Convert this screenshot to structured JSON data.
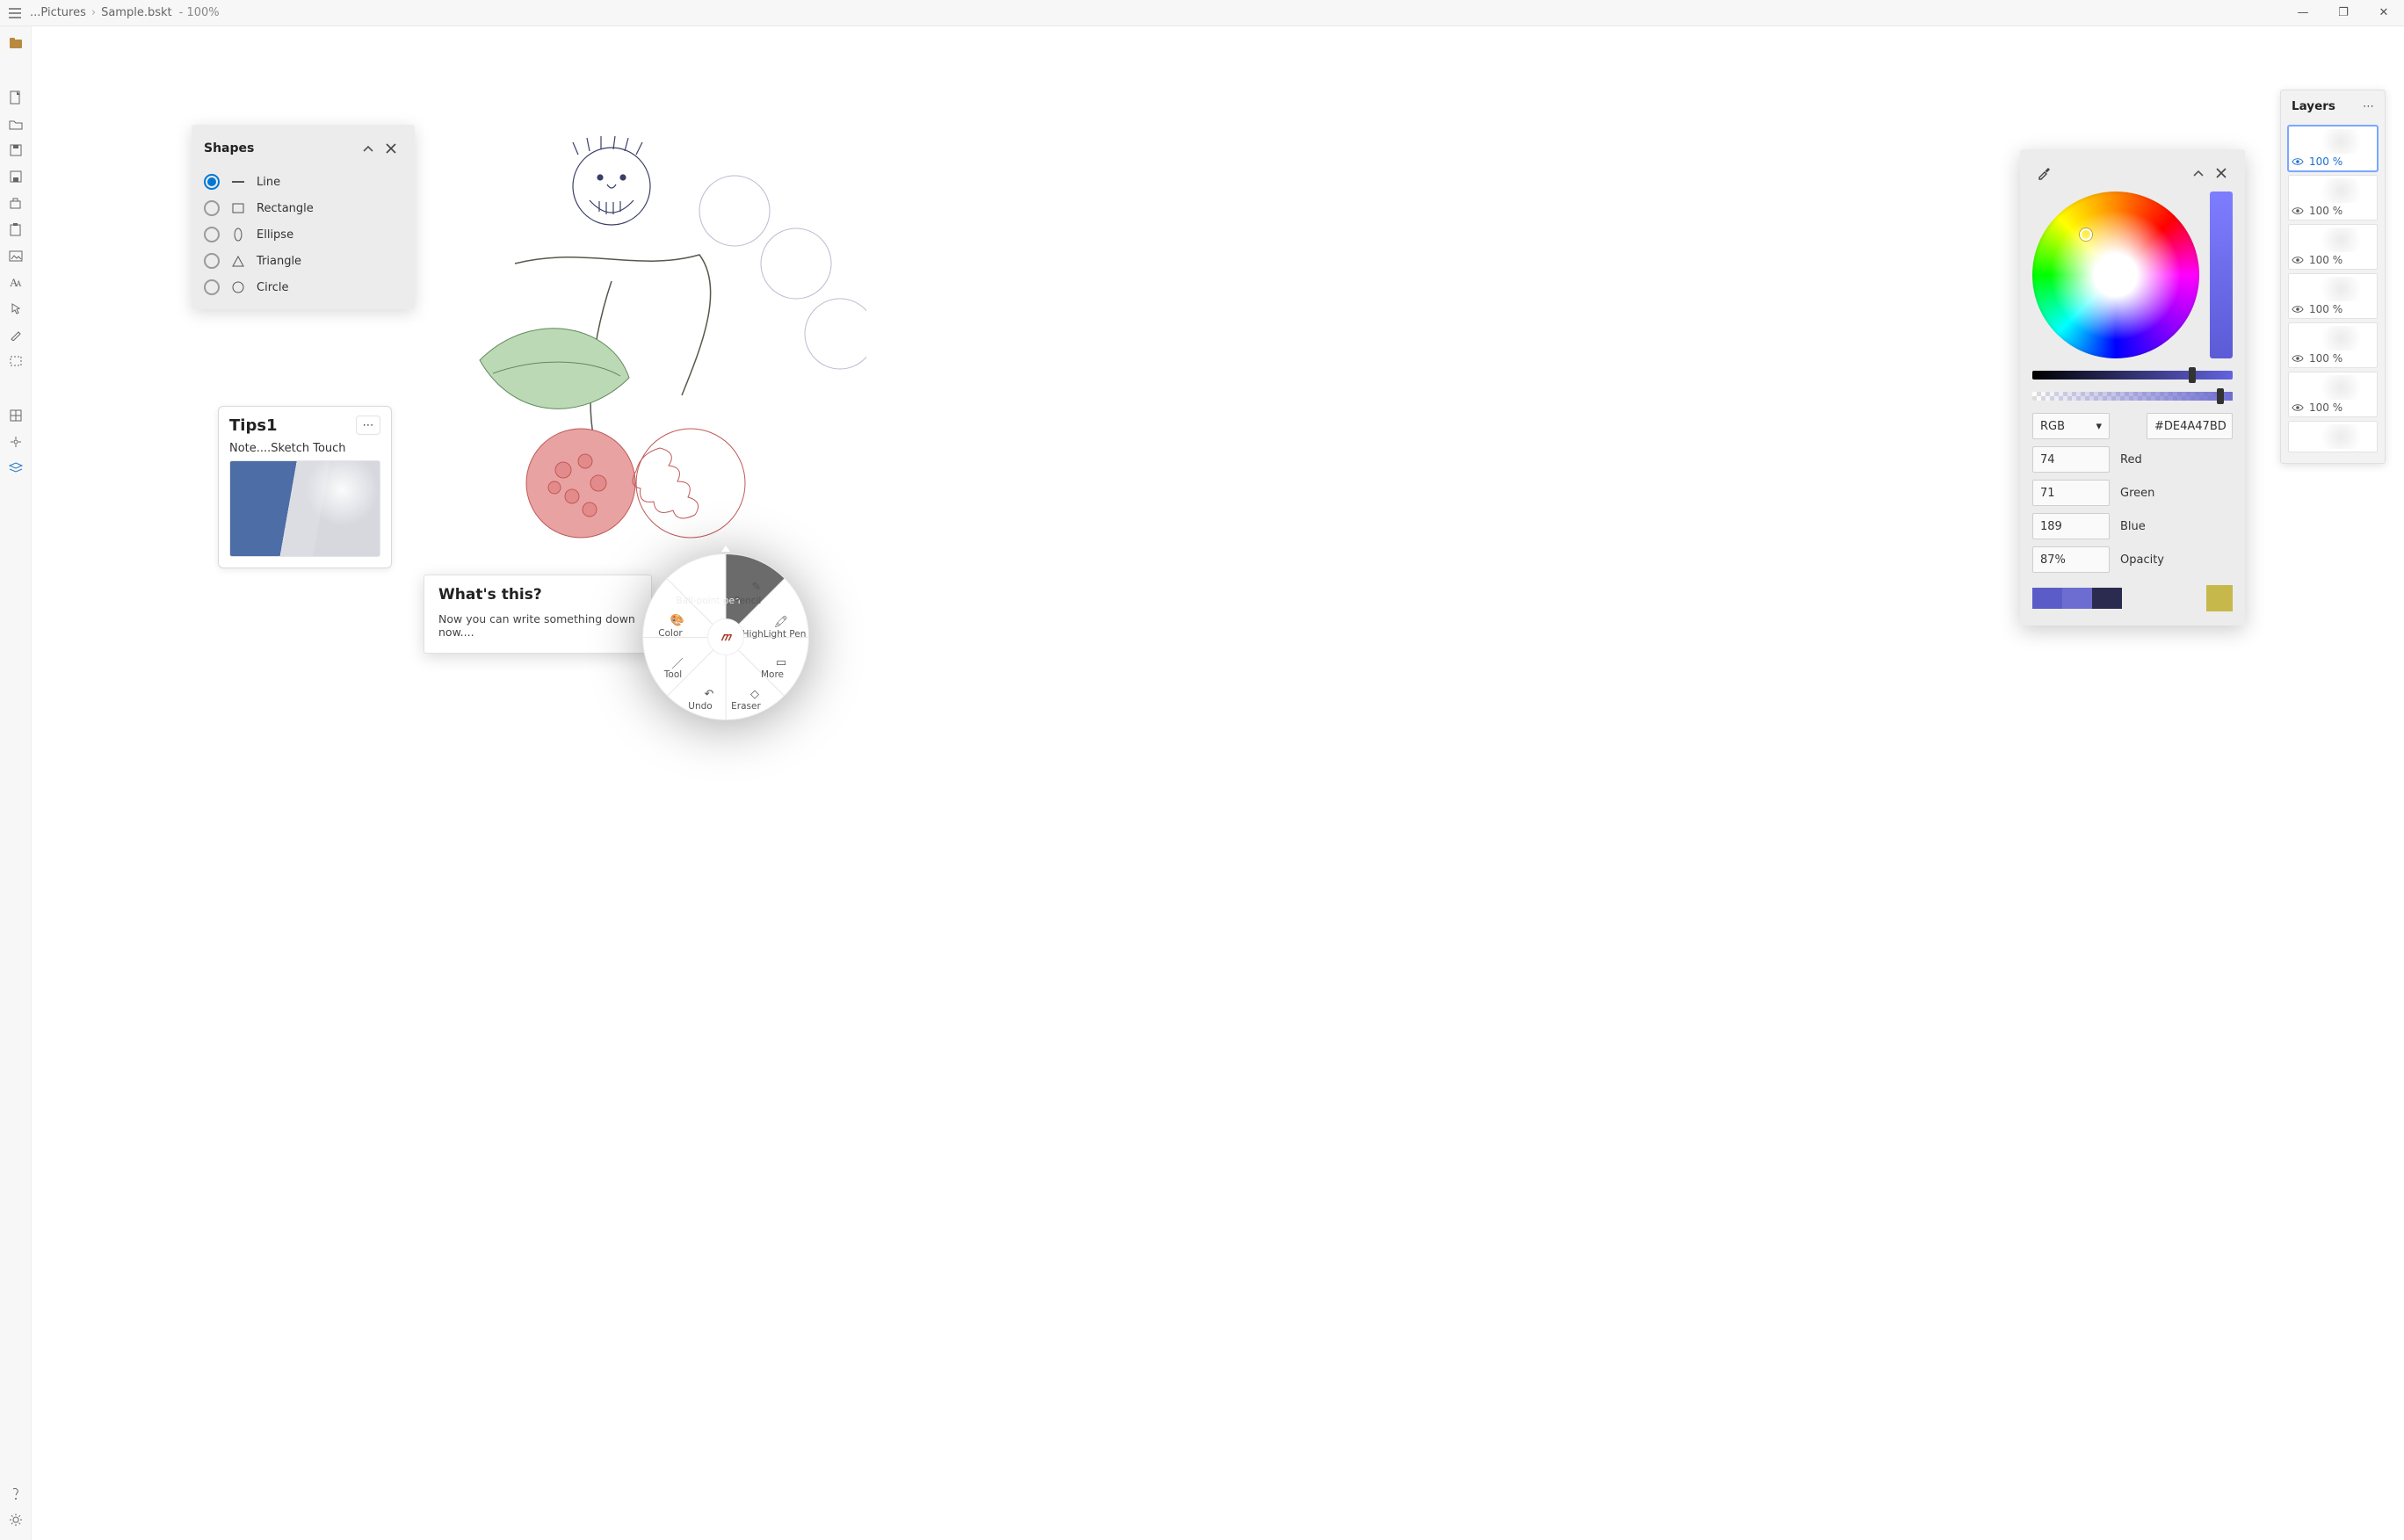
{
  "titlebar": {
    "path_prefix": "...Pictures",
    "file": "Sample.bskt",
    "zoom": "100%"
  },
  "window_ctrls": {
    "min": "—",
    "max": "❐",
    "close": "✕"
  },
  "leftrail": [
    {
      "name": "files-active-icon"
    },
    {
      "name": "new-file-icon"
    },
    {
      "name": "open-folder-icon"
    },
    {
      "name": "save-icon"
    },
    {
      "name": "save-as-icon"
    },
    {
      "name": "store-icon"
    },
    {
      "name": "clipboard-icon"
    },
    {
      "name": "image-icon"
    },
    {
      "name": "text-icon"
    },
    {
      "name": "pointer-icon"
    },
    {
      "name": "pen-icon"
    },
    {
      "name": "selection-icon"
    },
    {
      "name": "grid-icon"
    },
    {
      "name": "target-icon"
    },
    {
      "name": "layers-icon"
    }
  ],
  "shapes": {
    "title": "Shapes",
    "items": [
      {
        "key": "line",
        "label": "Line",
        "selected": true
      },
      {
        "key": "rectangle",
        "label": "Rectangle",
        "selected": false
      },
      {
        "key": "ellipse",
        "label": "Ellipse",
        "selected": false
      },
      {
        "key": "triangle",
        "label": "Triangle",
        "selected": false
      },
      {
        "key": "circle",
        "label": "Circle",
        "selected": false
      }
    ]
  },
  "tips": {
    "title": "Tips1",
    "subtitle": "Note....Sketch Touch"
  },
  "whats": {
    "title": "What's this?",
    "desc": "Now you can write something down now...."
  },
  "radial": {
    "center_glyph": "𝑚",
    "items": [
      {
        "label": "Ball-point pen",
        "icon": "bpen-icon"
      },
      {
        "label": "Pencil",
        "icon": "pencil-icon"
      },
      {
        "label": "HighLight Pen",
        "icon": "highlight-icon"
      },
      {
        "label": "More",
        "icon": "more-icon"
      },
      {
        "label": "Eraser",
        "icon": "eraser-icon"
      },
      {
        "label": "Undo",
        "icon": "undo-icon"
      },
      {
        "label": "Tool",
        "icon": "tool-icon"
      },
      {
        "label": "Color",
        "icon": "palette-icon"
      }
    ],
    "selected_index": 0
  },
  "color": {
    "mode": "RGB",
    "hex": "#DE4A47BD",
    "red": "74",
    "green": "71",
    "blue": "189",
    "opacity": "87%",
    "labels": {
      "red": "Red",
      "green": "Green",
      "blue": "Blue",
      "opacity": "Opacity"
    },
    "swatches": [
      "#5c5cc9",
      "#6d6dd1",
      "#2b2b4f"
    ],
    "swatch_extra": "#c7b84b"
  },
  "layers": {
    "title": "Layers",
    "items": [
      {
        "opacity": "100 %",
        "selected": true
      },
      {
        "opacity": "100 %",
        "selected": false
      },
      {
        "opacity": "100 %",
        "selected": false
      },
      {
        "opacity": "100 %",
        "selected": false
      },
      {
        "opacity": "100 %",
        "selected": false
      },
      {
        "opacity": "100 %",
        "selected": false
      }
    ],
    "extra_preview": true
  }
}
